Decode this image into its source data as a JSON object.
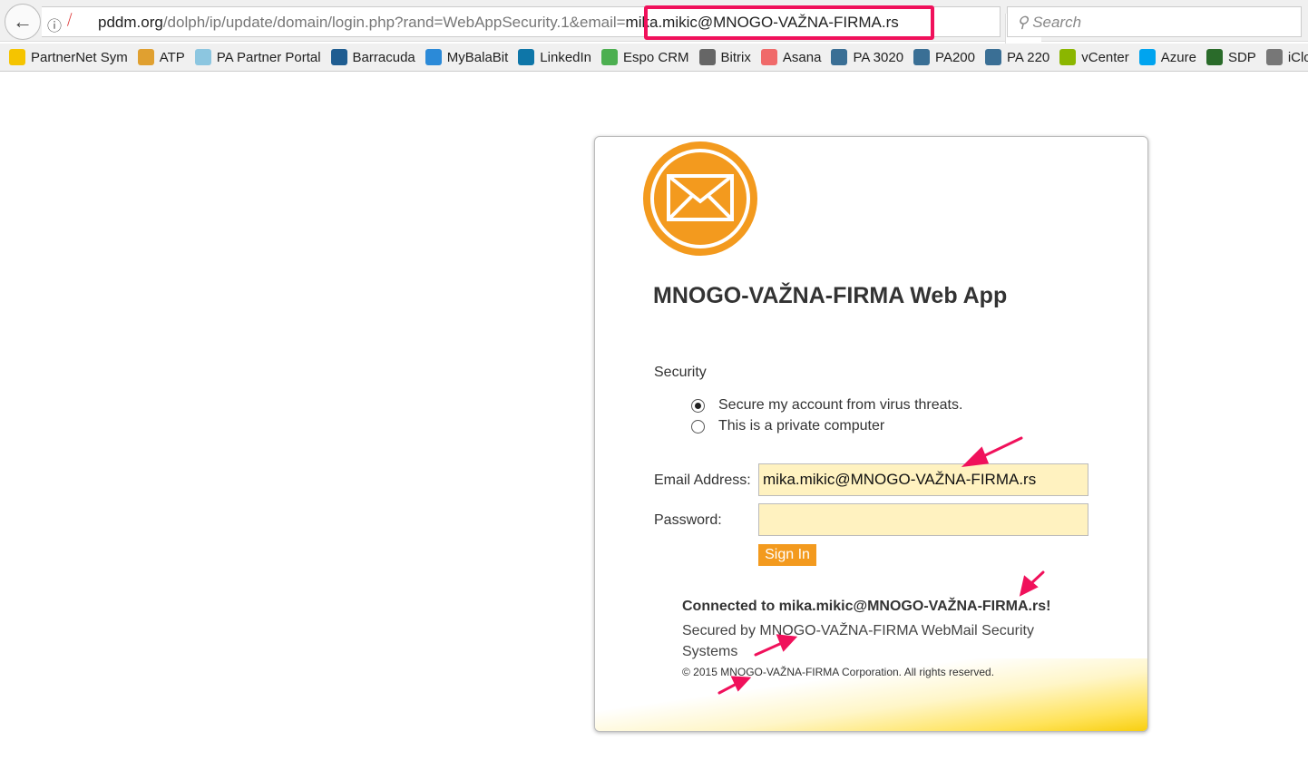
{
  "browser": {
    "url_host": "pddm.org",
    "url_path": "/dolph/ip/update/domain/login.php?rand=WebAppSecurity.1&email=",
    "url_email": "mika.mikic@MNOGO-VAŽNA-FIRMA.rs",
    "search_placeholder": "Search",
    "bookmarks": [
      {
        "label": "PartnerNet Sym",
        "icon": "symantec-check-icon",
        "color": "#f5c400"
      },
      {
        "label": "ATP",
        "icon": "atp-icon",
        "color": "#e0a030"
      },
      {
        "label": "PA Partner Portal",
        "icon": "palo-alto-icon",
        "color": "#8cc6e0"
      },
      {
        "label": "Barracuda",
        "icon": "barracuda-icon",
        "color": "#1f5d91"
      },
      {
        "label": "MyBalaBit",
        "icon": "balabit-icon",
        "color": "#2b8ad8"
      },
      {
        "label": "LinkedIn",
        "icon": "linkedin-icon",
        "color": "#0e76a8"
      },
      {
        "label": "Espo CRM",
        "icon": "espo-icon",
        "color": "#4caf50"
      },
      {
        "label": "Bitrix",
        "icon": "globe-icon",
        "color": "#666666"
      },
      {
        "label": "Asana",
        "icon": "asana-icon",
        "color": "#f06a6a"
      },
      {
        "label": "PA 3020",
        "icon": "palo-alto-icon",
        "color": "#3a6f95"
      },
      {
        "label": "PA200",
        "icon": "palo-alto-icon",
        "color": "#3a6f95"
      },
      {
        "label": "PA 220",
        "icon": "palo-alto-icon",
        "color": "#3a6f95"
      },
      {
        "label": "vCenter",
        "icon": "vcenter-icon",
        "color": "#8bb600"
      },
      {
        "label": "Azure",
        "icon": "microsoft-icon",
        "color": "#00a4ef"
      },
      {
        "label": "SDP",
        "icon": "sdp-icon",
        "color": "#2a6b2a"
      },
      {
        "label": "iCloud",
        "icon": "apple-icon",
        "color": "#777777"
      }
    ]
  },
  "login": {
    "title": "MNOGO-VAŽNA-FIRMA Web App",
    "security_label": "Security",
    "options": [
      "Secure my account from virus threats.",
      "This is a private computer"
    ],
    "selected_option": 0,
    "email_label": "Email Address:",
    "email_value": "mika.mikic@MNOGO-VAŽNA-FIRMA.rs",
    "password_label": "Password:",
    "password_value": "",
    "sign_in": "Sign In",
    "connected": "Connected to mika.mikic@MNOGO-VAŽNA-FIRMA.rs!",
    "secured_by": "Secured by MNOGO-VAŽNA-FIRMA WebMail Security Systems",
    "copyright": "© 2015 MNOGO-VAŽNA-FIRMA Corporation. All rights reserved."
  },
  "colors": {
    "accent": "#f39a1e",
    "annotation": "#f0115b",
    "input_bg": "#fff2c0"
  }
}
